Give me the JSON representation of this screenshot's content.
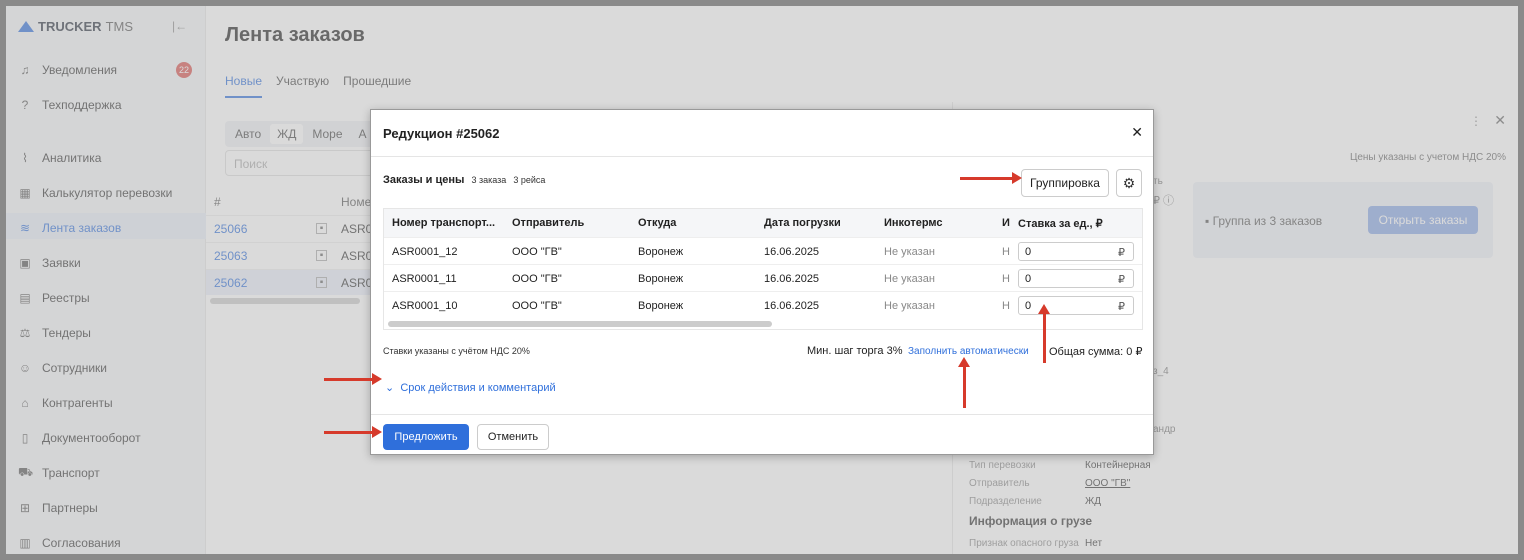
{
  "app": {
    "logo": "TRUCKER",
    "logo_suffix": "TMS",
    "collapse_glyph": "|←"
  },
  "sidebar": {
    "notifications_badge": "22",
    "items": [
      {
        "label": "Уведомления",
        "icon": "bell-icon",
        "glyph": "♫"
      },
      {
        "label": "Техподдержка",
        "icon": "help-icon",
        "glyph": "?"
      },
      {
        "label": "Аналитика",
        "icon": "chart-icon",
        "glyph": "⌇"
      },
      {
        "label": "Калькулятор перевозки",
        "icon": "calculator-icon",
        "glyph": "▦"
      },
      {
        "label": "Лента заказов",
        "icon": "feed-icon",
        "glyph": "≋"
      },
      {
        "label": "Заявки",
        "icon": "requests-icon",
        "glyph": "▣"
      },
      {
        "label": "Реестры",
        "icon": "registry-icon",
        "glyph": "▤"
      },
      {
        "label": "Тендеры",
        "icon": "tender-icon",
        "glyph": "⚖"
      },
      {
        "label": "Сотрудники",
        "icon": "user-icon",
        "glyph": "☺"
      },
      {
        "label": "Контрагенты",
        "icon": "bank-icon",
        "glyph": "⌂"
      },
      {
        "label": "Документооборот",
        "icon": "document-icon",
        "glyph": "▯"
      },
      {
        "label": "Транспорт",
        "icon": "truck-icon",
        "glyph": "⛟"
      },
      {
        "label": "Партнеры",
        "icon": "partners-icon",
        "glyph": "⊞"
      },
      {
        "label": "Согласования",
        "icon": "approval-icon",
        "glyph": "▥"
      }
    ]
  },
  "main": {
    "title": "Лента заказов",
    "tabs": [
      "Новые",
      "Участвую",
      "Прошедшие"
    ],
    "modes": [
      "Авто",
      "ЖД",
      "Море",
      "А"
    ],
    "search_placeholder": "Поиск",
    "table_headers": [
      "#",
      "Номе"
    ],
    "orders": [
      {
        "num": "25066",
        "asr": "ASR0"
      },
      {
        "num": "25063",
        "asr": "ASR0"
      },
      {
        "num": "25062",
        "asr": "ASR0"
      }
    ]
  },
  "right_panel": {
    "vat_note": "Цены указаны с учетом НДС 20%",
    "group_label": "Группа из 3 заказов",
    "open_orders_button": "Открыть заказы",
    "frag_1": "ть",
    "frag_2": "₽ ⓘ",
    "frag_3": "з_4",
    "frag_4": "андр",
    "details": [
      {
        "key": "Тип перевозки",
        "value": "Контейнерная"
      },
      {
        "key": "Отправитель",
        "value": "ООО \"ГВ\""
      },
      {
        "key": "Подразделение",
        "value": "ЖД"
      }
    ],
    "cargo_heading": "Информация о грузе",
    "cargo": {
      "key": "Признак опасного груза",
      "value": "Нет"
    }
  },
  "modal": {
    "title": "Редукцион #25062",
    "section_title": "Заказы и цены",
    "orders_pill": "3 заказа",
    "trips_pill": "3 рейса",
    "group_button": "Группировка",
    "columns": [
      "Номер транспорт...",
      "Отправитель",
      "Откуда",
      "Дата погрузки",
      "Инкотермс",
      "И",
      "Ставка за ед., ₽"
    ],
    "rows": [
      {
        "transport": "ASR0001_12",
        "sender": "ООО \"ГВ\"",
        "from": "Воронеж",
        "date": "16.06.2025",
        "incoterms": "Не указан",
        "i": "Н",
        "rate": "0"
      },
      {
        "transport": "ASR0001_11",
        "sender": "ООО \"ГВ\"",
        "from": "Воронеж",
        "date": "16.06.2025",
        "incoterms": "Не указан",
        "i": "Н",
        "rate": "0"
      },
      {
        "transport": "ASR0001_10",
        "sender": "ООО \"ГВ\"",
        "from": "Воронеж",
        "date": "16.06.2025",
        "incoterms": "Не указан",
        "i": "Н",
        "rate": "0"
      }
    ],
    "currency": "₽",
    "vat_note": "Ставки указаны с учётом НДС 20%",
    "min_step": "Мин. шаг торга 3%",
    "autofill_link": "Заполнить автоматически",
    "total": "Общая сумма: 0 ₽",
    "expand_label": "Срок действия и комментарий",
    "submit_button": "Предложить",
    "cancel_button": "Отменить"
  },
  "colors": {
    "accent": "#2f6fdb",
    "arrow": "#d63a2b",
    "badge": "#d9534f"
  }
}
